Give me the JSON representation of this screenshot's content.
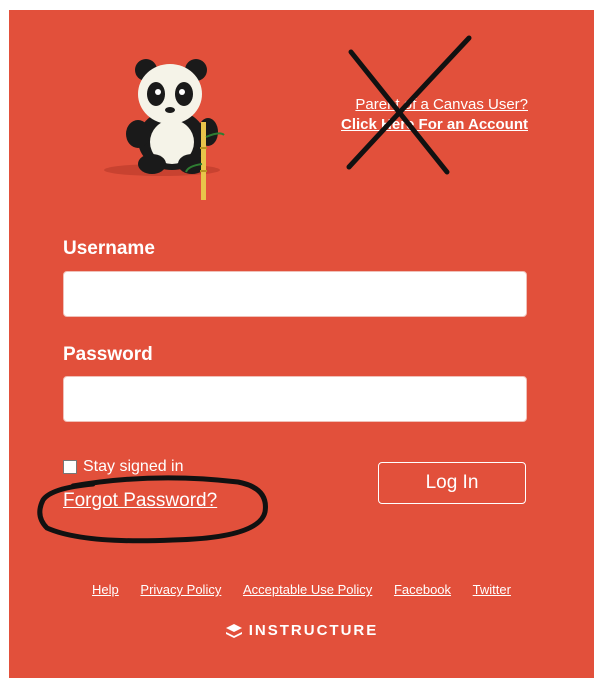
{
  "parent_link": {
    "line1": "Parent of a Canvas User?",
    "line2": "Click Here For an Account"
  },
  "form": {
    "username_label": "Username",
    "username_value": "",
    "password_label": "Password",
    "password_value": "",
    "stay_signed_in": "Stay signed in",
    "forgot_password": "Forgot Password?",
    "login_button": "Log In"
  },
  "footer": {
    "links": [
      "Help",
      "Privacy Policy",
      "Acceptable Use Policy",
      "Facebook",
      "Twitter"
    ],
    "brand": "INSTRUCTURE"
  },
  "colors": {
    "background": "#e2503b",
    "text": "#ffffff"
  }
}
